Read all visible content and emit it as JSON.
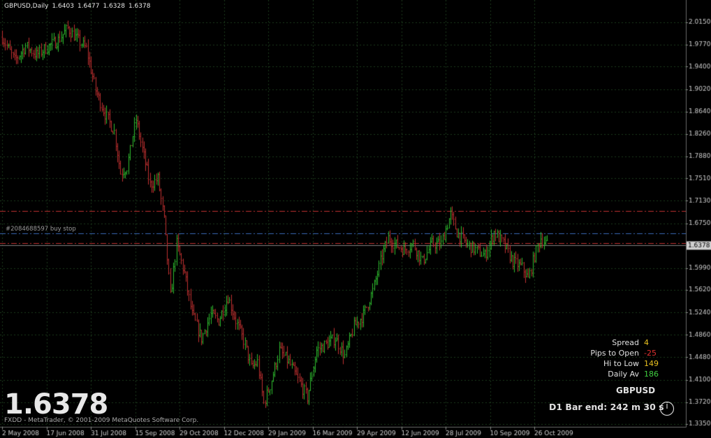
{
  "header": {
    "symbol": "GBPUSD,Daily",
    "open": "1.6403",
    "high": "1.6477",
    "low": "1.6328",
    "close": "1.6378"
  },
  "order_label": "#2084688597 buy stop",
  "big_price": "1.6378",
  "copyright": "FXDD - MetaTrader, © 2001-2009 MetaQuotes Software Corp.",
  "info_panel": [
    {
      "label": "Spread",
      "value": "4",
      "color": "#e8c020"
    },
    {
      "label": "Pips to Open",
      "value": "-25",
      "color": "#e03030"
    },
    {
      "label": "Hi to Low",
      "value": "149",
      "color": "#e8c020"
    },
    {
      "label": "Daily Av",
      "value": "186",
      "color": "#40d040"
    }
  ],
  "symbol_title": "GBPUSD",
  "bar_end": "D1 Bar end: 242 m 30 s",
  "colors": {
    "background": "#000000",
    "grid": "#1c3a1c",
    "bull": "#2fbf2f",
    "bear": "#c03030",
    "axis_text": "#cccccc",
    "stop_line": "#c03030",
    "order_line": "#3a6ab8",
    "bid_line": "#808080"
  },
  "chart_data": {
    "type": "candlestick",
    "title": "GBPUSD,Daily",
    "ylim": [
      1.335,
      2.015
    ],
    "y_ticks": [
      "2.0150",
      "1.9770",
      "1.9400",
      "1.9020",
      "1.8640",
      "1.8260",
      "1.7880",
      "1.7510",
      "1.7130",
      "1.6750",
      "1.6378",
      "1.5990",
      "1.5620",
      "1.5240",
      "1.4860",
      "1.4480",
      "1.4100",
      "1.3720",
      "1.3350"
    ],
    "current_price": "1.6378",
    "x_ticks": [
      "2 May 2008",
      "17 Jun 2008",
      "31 Jul 2008",
      "15 Sep 2008",
      "29 Oct 2008",
      "12 Dec 2008",
      "29 Jan 2009",
      "16 Mar 2009",
      "29 Apr 2009",
      "12 Jun 2009",
      "28 Jul 2009",
      "10 Sep 2009",
      "26 Oct 2009"
    ],
    "horizontal_lines": [
      {
        "name": "stop-level-upper",
        "price": 1.696,
        "style": "dash-dot",
        "color": "#c03030"
      },
      {
        "name": "buy-stop-order",
        "price": 1.6578,
        "style": "dash-dot",
        "color": "#3a6ab8"
      },
      {
        "name": "stop-level-lower",
        "price": 1.641,
        "style": "dash-dot",
        "color": "#c03030"
      }
    ],
    "close_path": [
      [
        0,
        1.99
      ],
      [
        8,
        1.95
      ],
      [
        15,
        1.975
      ],
      [
        22,
        1.96
      ],
      [
        30,
        1.975
      ],
      [
        36,
        1.985
      ],
      [
        42,
        2.005
      ],
      [
        47,
        1.99
      ],
      [
        54,
        1.97
      ],
      [
        60,
        1.9
      ],
      [
        66,
        1.86
      ],
      [
        72,
        1.83
      ],
      [
        76,
        1.76
      ],
      [
        80,
        1.77
      ],
      [
        86,
        1.85
      ],
      [
        90,
        1.8
      ],
      [
        95,
        1.74
      ],
      [
        100,
        1.75
      ],
      [
        104,
        1.68
      ],
      [
        108,
        1.55
      ],
      [
        112,
        1.64
      ],
      [
        117,
        1.59
      ],
      [
        122,
        1.52
      ],
      [
        128,
        1.48
      ],
      [
        134,
        1.52
      ],
      [
        139,
        1.51
      ],
      [
        145,
        1.55
      ],
      [
        150,
        1.51
      ],
      [
        156,
        1.47
      ],
      [
        160,
        1.43
      ],
      [
        164,
        1.44
      ],
      [
        168,
        1.37
      ],
      [
        172,
        1.4
      ],
      [
        178,
        1.46
      ],
      [
        184,
        1.44
      ],
      [
        190,
        1.41
      ],
      [
        196,
        1.38
      ],
      [
        202,
        1.46
      ],
      [
        208,
        1.47
      ],
      [
        214,
        1.48
      ],
      [
        220,
        1.45
      ],
      [
        226,
        1.5
      ],
      [
        232,
        1.52
      ],
      [
        238,
        1.56
      ],
      [
        244,
        1.62
      ],
      [
        248,
        1.65
      ],
      [
        252,
        1.64
      ],
      [
        258,
        1.63
      ],
      [
        264,
        1.64
      ],
      [
        270,
        1.61
      ],
      [
        276,
        1.64
      ],
      [
        282,
        1.64
      ],
      [
        288,
        1.69
      ],
      [
        292,
        1.66
      ],
      [
        298,
        1.64
      ],
      [
        304,
        1.63
      ],
      [
        310,
        1.62
      ],
      [
        316,
        1.66
      ],
      [
        322,
        1.64
      ],
      [
        328,
        1.61
      ],
      [
        334,
        1.6
      ],
      [
        338,
        1.58
      ],
      [
        342,
        1.62
      ],
      [
        346,
        1.65
      ],
      [
        350,
        1.638
      ]
    ]
  }
}
